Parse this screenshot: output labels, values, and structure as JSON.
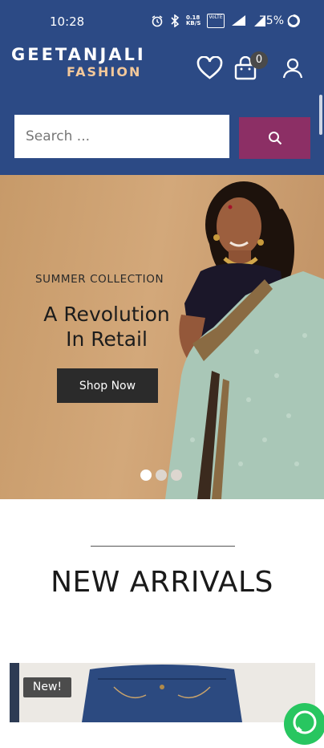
{
  "status_bar": {
    "time": "10:28",
    "battery": "75%",
    "icons": [
      "alarm-icon",
      "bluetooth-icon",
      "data-speed-icon",
      "volte-icon",
      "wifi-icon",
      "signal-icon",
      "battery-icon"
    ],
    "data_speed_text": "0.18 KB/S",
    "volte_text": "VoLTE"
  },
  "header": {
    "logo_line1": "GEETANJALI",
    "logo_line2": "FASHION",
    "cart_count": "0",
    "colors": {
      "background": "#2c4a85",
      "accent": "#8c2f65",
      "logo_sub": "#f3c89a"
    }
  },
  "search": {
    "placeholder": "Search ...",
    "value": ""
  },
  "hero": {
    "kicker": "SUMMER COLLECTION",
    "headline_line1": "A Revolution",
    "headline_line2": "In Retail",
    "cta_label": "Shop Now",
    "slides_total": 3,
    "active_slide": 1
  },
  "new_arrivals": {
    "title": "NEW ARRIVALS",
    "badge": "New!"
  },
  "floating": {
    "icon": "whatsapp-icon"
  }
}
